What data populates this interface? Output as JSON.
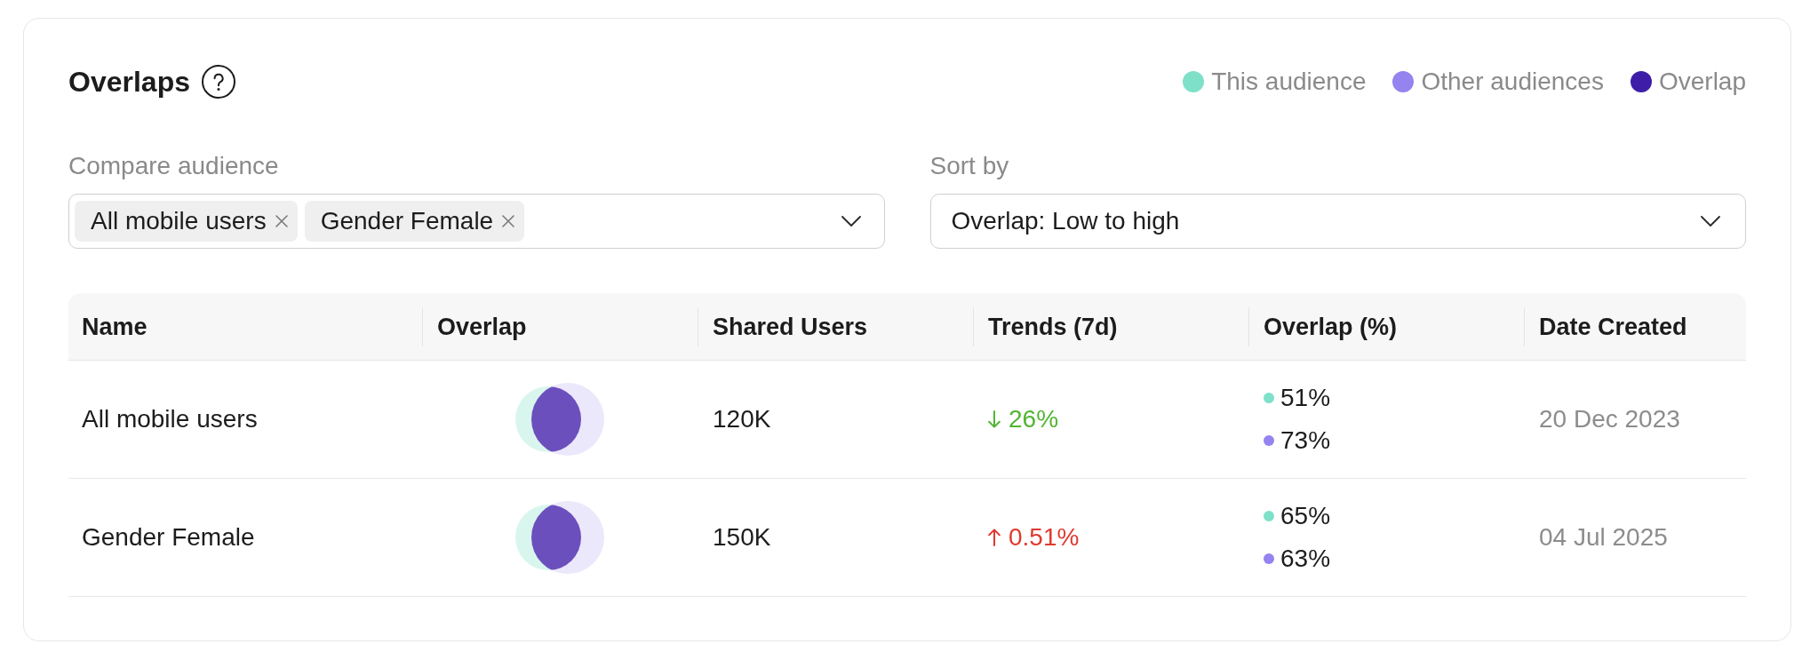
{
  "header": {
    "title": "Overlaps"
  },
  "legend": [
    {
      "label": "This audience",
      "color": "#7fe0c9"
    },
    {
      "label": "Other audiences",
      "color": "#9583f0"
    },
    {
      "label": "Overlap",
      "color": "#3e1ea8"
    }
  ],
  "compare_audience": {
    "label": "Compare audience",
    "chips": [
      "All mobile users",
      "Gender Female"
    ]
  },
  "sort_by": {
    "label": "Sort by",
    "value": "Overlap: Low to high"
  },
  "table": {
    "columns": [
      "Name",
      "Overlap",
      "Shared Users",
      "Trends (7d)",
      "Overlap (%)",
      "Date Created"
    ],
    "rows": [
      {
        "name": "All mobile users",
        "shared_users": "120K",
        "trend": {
          "kind": "decrease",
          "value": "26%"
        },
        "overlap_percent": [
          {
            "value": "51%",
            "color": "#7fe0c9"
          },
          {
            "value": "73%",
            "color": "#9583f0"
          }
        ],
        "date_created": "20 Dec 2023"
      },
      {
        "name": "Gender Female",
        "shared_users": "150K",
        "trend": {
          "kind": "increase",
          "value": "0.51%"
        },
        "overlap_percent": [
          {
            "value": "65%",
            "color": "#7fe0c9"
          },
          {
            "value": "63%",
            "color": "#9583f0"
          }
        ],
        "date_created": "04 Jul 2025"
      }
    ]
  }
}
